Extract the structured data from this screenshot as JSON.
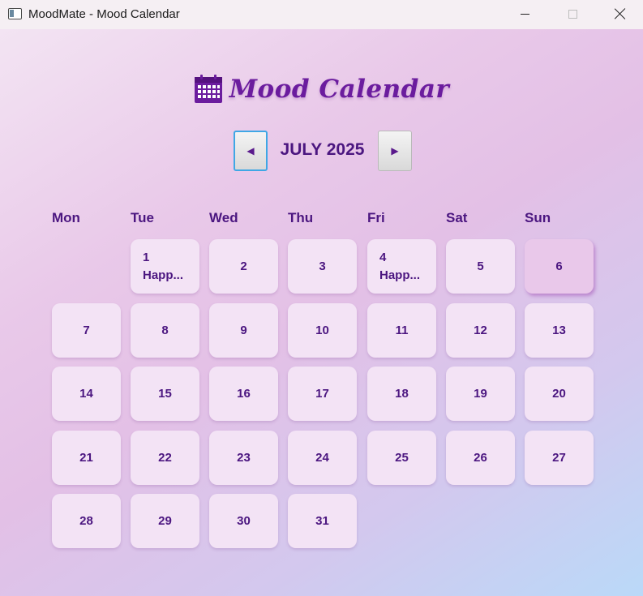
{
  "window": {
    "title": "MoodMate - Mood Calendar",
    "controls": [
      "minimize",
      "maximize",
      "close"
    ]
  },
  "header": {
    "title": "Mood Calendar",
    "icon": "calendar-icon",
    "accent_color": "#6b1c9e"
  },
  "nav": {
    "prev_label": "◀",
    "next_label": "▶",
    "month_label": "JULY 2025"
  },
  "weekdays": [
    "Mon",
    "Tue",
    "Wed",
    "Thu",
    "Fri",
    "Sat",
    "Sun"
  ],
  "days": [
    {
      "num": "1",
      "mood": "Happ..."
    },
    {
      "num": "2",
      "mood": ""
    },
    {
      "num": "3",
      "mood": ""
    },
    {
      "num": "4",
      "mood": "Happ..."
    },
    {
      "num": "5",
      "mood": ""
    },
    {
      "num": "6",
      "mood": "",
      "today": true
    },
    {
      "num": "7",
      "mood": ""
    },
    {
      "num": "8",
      "mood": ""
    },
    {
      "num": "9",
      "mood": ""
    },
    {
      "num": "10",
      "mood": ""
    },
    {
      "num": "11",
      "mood": ""
    },
    {
      "num": "12",
      "mood": ""
    },
    {
      "num": "13",
      "mood": ""
    },
    {
      "num": "14",
      "mood": ""
    },
    {
      "num": "15",
      "mood": ""
    },
    {
      "num": "16",
      "mood": ""
    },
    {
      "num": "17",
      "mood": ""
    },
    {
      "num": "18",
      "mood": ""
    },
    {
      "num": "19",
      "mood": ""
    },
    {
      "num": "20",
      "mood": ""
    },
    {
      "num": "21",
      "mood": ""
    },
    {
      "num": "22",
      "mood": ""
    },
    {
      "num": "23",
      "mood": ""
    },
    {
      "num": "24",
      "mood": ""
    },
    {
      "num": "25",
      "mood": ""
    },
    {
      "num": "26",
      "mood": ""
    },
    {
      "num": "27",
      "mood": ""
    },
    {
      "num": "28",
      "mood": ""
    },
    {
      "num": "29",
      "mood": ""
    },
    {
      "num": "30",
      "mood": ""
    },
    {
      "num": "31",
      "mood": ""
    }
  ]
}
